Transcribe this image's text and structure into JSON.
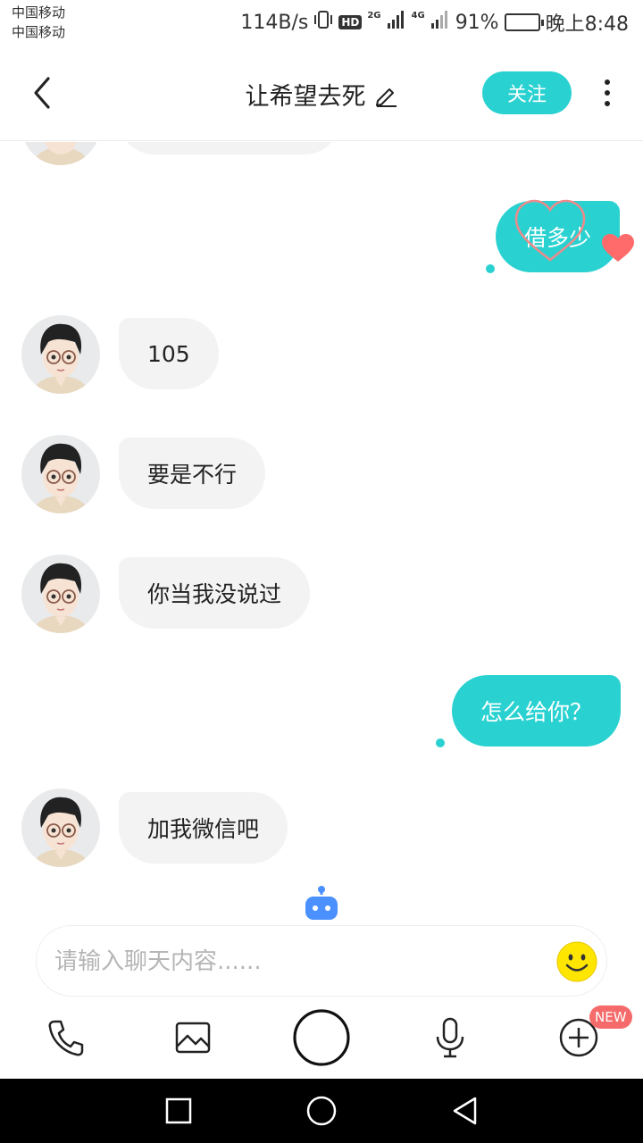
{
  "status_bar": {
    "carrier_1": "中国移动",
    "carrier_2": "中国移动",
    "net_speed": "114B/s",
    "hd": "HD",
    "net_2g": "2G",
    "net_4g": "4G",
    "battery": "91%",
    "time": "晚上8:48",
    "battery_level": 0.91
  },
  "header": {
    "title": "让希望去死",
    "follow_label": "关注",
    "icons": [
      "back-arrow-icon",
      "edit-pencil-icon",
      "more-vertical-icon"
    ]
  },
  "messages": [
    {
      "side": "out",
      "text": "借多少"
    },
    {
      "side": "in",
      "text": "105"
    },
    {
      "side": "in",
      "text": "要是不行"
    },
    {
      "side": "in",
      "text": "你当我没说过"
    },
    {
      "side": "out",
      "text": "怎么给你？"
    },
    {
      "side": "in",
      "text": "加我微信吧"
    }
  ],
  "input": {
    "placeholder": "请输入聊天内容......"
  },
  "toolbar": {
    "new_badge": "NEW",
    "icons": [
      "phone-icon",
      "image-icon",
      "record-circle-icon",
      "microphone-icon",
      "plus-circle-icon"
    ]
  },
  "colors": {
    "accent": "#2ad1d1",
    "incoming_bubble": "#f3f3f3",
    "heart": "#ff6b6b",
    "badge": "#f56b6b",
    "robot": "#4a90ff"
  }
}
